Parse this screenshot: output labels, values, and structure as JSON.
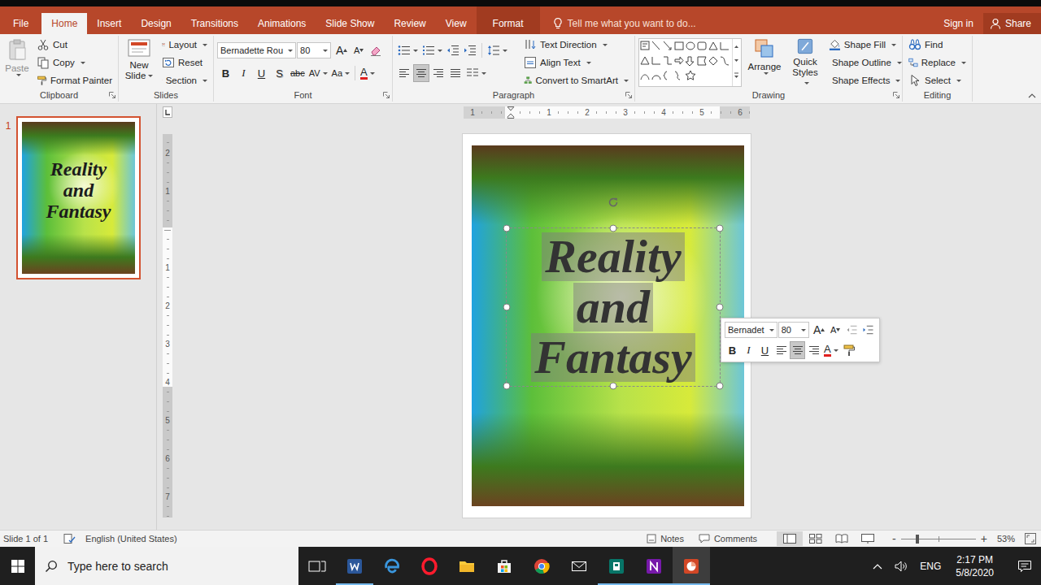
{
  "ribbon_tabs": [
    {
      "label": "File",
      "selected": false,
      "kind": "file"
    },
    {
      "label": "Home",
      "selected": true,
      "kind": "standard"
    },
    {
      "label": "Insert",
      "selected": false,
      "kind": "standard"
    },
    {
      "label": "Design",
      "selected": false,
      "kind": "standard"
    },
    {
      "label": "Transitions",
      "selected": false,
      "kind": "standard"
    },
    {
      "label": "Animations",
      "selected": false,
      "kind": "standard"
    },
    {
      "label": "Slide Show",
      "selected": false,
      "kind": "standard"
    },
    {
      "label": "Review",
      "selected": false,
      "kind": "standard"
    },
    {
      "label": "View",
      "selected": false,
      "kind": "standard"
    },
    {
      "label": "Format",
      "selected": false,
      "kind": "contextual"
    }
  ],
  "tell_me": {
    "placeholder": "Tell me what you want to do..."
  },
  "account": {
    "sign_in": "Sign in",
    "share": "Share"
  },
  "clipboard_group": {
    "label": "Clipboard",
    "paste": {
      "label": "Paste",
      "disabled": true
    },
    "items": [
      {
        "label": "Cut",
        "kind": "cut",
        "dropdown": false
      },
      {
        "label": "Copy",
        "kind": "copy",
        "dropdown": true
      },
      {
        "label": "Format Painter",
        "kind": "painter",
        "dropdown": false
      }
    ]
  },
  "slides_group": {
    "label": "Slides",
    "new_slide": "New Slide",
    "items": [
      {
        "label": "Layout",
        "kind": "layout",
        "dropdown": true
      },
      {
        "label": "Reset",
        "kind": "reset",
        "dropdown": false
      },
      {
        "label": "Section",
        "kind": "section",
        "dropdown": true
      }
    ]
  },
  "font_group": {
    "label": "Font",
    "font_name": "Bernadette Rou",
    "font_size": "80",
    "grow": "A",
    "shrink": "A",
    "format_buttons": [
      {
        "glyph": "B",
        "kind": "bold",
        "dropdown": false
      },
      {
        "glyph": "I",
        "kind": "italic",
        "dropdown": false
      },
      {
        "glyph": "U",
        "kind": "underline",
        "dropdown": false
      },
      {
        "glyph": "S",
        "kind": "shadow",
        "dropdown": false
      },
      {
        "glyph": "abc",
        "kind": "strike",
        "dropdown": false
      },
      {
        "glyph": "AV",
        "kind": "spacing",
        "dropdown": true
      },
      {
        "glyph": "Aa",
        "kind": "case",
        "dropdown": true
      }
    ],
    "font_color_glyph": "A"
  },
  "paragraph_group": {
    "label": "Paragraph",
    "alignment": [
      {
        "kind": "left",
        "selected": false
      },
      {
        "kind": "center",
        "selected": true
      },
      {
        "kind": "right",
        "selected": false
      },
      {
        "kind": "justify",
        "selected": false
      }
    ],
    "items": [
      {
        "label": "Text Direction",
        "kind": "direction"
      },
      {
        "label": "Align Text",
        "kind": "align"
      },
      {
        "label": "Convert to SmartArt",
        "kind": "smartart"
      }
    ]
  },
  "drawing_group": {
    "label": "Drawing",
    "arrange": "Arrange",
    "quick_styles": "Quick Styles",
    "items": [
      {
        "label": "Shape Fill",
        "kind": "fill"
      },
      {
        "label": "Shape Outline",
        "kind": "outline"
      },
      {
        "label": "Shape Effects",
        "kind": "effects"
      }
    ]
  },
  "editing_group": {
    "label": "Editing",
    "items": [
      {
        "label": "Find",
        "kind": "find",
        "dropdown": false
      },
      {
        "label": "Replace",
        "kind": "replace",
        "dropdown": true
      },
      {
        "label": "Select",
        "kind": "select",
        "dropdown": true
      }
    ]
  },
  "slides": [
    {
      "number": "1",
      "selected": true,
      "title_lines": [
        "Reality",
        "and",
        "Fantasy"
      ]
    }
  ],
  "horizontal_ruler": [
    {
      "kind": "number",
      "label": "1"
    },
    {
      "kind": "marker"
    },
    {
      "kind": "number",
      "label": "1"
    },
    {
      "kind": "number",
      "label": "2"
    },
    {
      "kind": "number",
      "label": "3"
    },
    {
      "kind": "number",
      "label": "4"
    },
    {
      "kind": "number",
      "label": "5"
    },
    {
      "kind": "number",
      "label": "6"
    }
  ],
  "vertical_ruler": [
    {
      "kind": "number",
      "label": "2"
    },
    {
      "kind": "number",
      "label": "1"
    },
    {
      "kind": "origin"
    },
    {
      "kind": "number",
      "label": "1"
    },
    {
      "kind": "number",
      "label": "2"
    },
    {
      "kind": "number",
      "label": "3"
    },
    {
      "kind": "number",
      "label": "4"
    },
    {
      "kind": "number",
      "label": "5"
    },
    {
      "kind": "number",
      "label": "6"
    },
    {
      "kind": "number",
      "label": "7"
    }
  ],
  "text_box": {
    "selected": true,
    "text_selected": true
  },
  "mini_toolbar": {
    "font_name": "Bernadet",
    "font_size": "80",
    "grow": "A",
    "shrink": "A",
    "format_buttons": [
      {
        "glyph": "B",
        "kind": "bold"
      },
      {
        "glyph": "I",
        "kind": "italic"
      },
      {
        "glyph": "U",
        "kind": "underline"
      }
    ],
    "alignment": [
      {
        "kind": "left",
        "selected": false
      },
      {
        "kind": "center",
        "selected": true
      },
      {
        "kind": "right",
        "selected": false
      }
    ],
    "font_color_glyph": "A"
  },
  "status_bar": {
    "slide_info": "Slide 1 of 1",
    "language": "English (United States)",
    "notes": "Notes",
    "comments": "Comments",
    "views": [
      {
        "kind": "normal",
        "selected": true
      },
      {
        "kind": "sorter",
        "selected": false
      },
      {
        "kind": "reading",
        "selected": false
      },
      {
        "kind": "slideshow",
        "selected": false
      }
    ],
    "zoom_out": "-",
    "zoom_in": "+",
    "zoom_level": 0.22,
    "zoom": "53%"
  },
  "taskbar": {
    "search_placeholder": "Type here to search",
    "apps": [
      {
        "kind": "task-view",
        "running": false,
        "active": false
      },
      {
        "kind": "word",
        "running": true,
        "active": false
      },
      {
        "kind": "edge",
        "running": false,
        "active": false
      },
      {
        "kind": "opera",
        "running": false,
        "active": false
      },
      {
        "kind": "explorer",
        "running": false,
        "active": false
      },
      {
        "kind": "store",
        "running": false,
        "active": false
      },
      {
        "kind": "chrome",
        "running": false,
        "active": false
      },
      {
        "kind": "mail",
        "running": false,
        "active": false
      },
      {
        "kind": "publisher",
        "running": true,
        "active": false
      },
      {
        "kind": "onenote",
        "running": true,
        "active": false
      },
      {
        "kind": "powerpoint",
        "running": true,
        "active": true
      }
    ],
    "language": "ENG",
    "time": "2:17 PM",
    "date": "5/8/2020"
  }
}
